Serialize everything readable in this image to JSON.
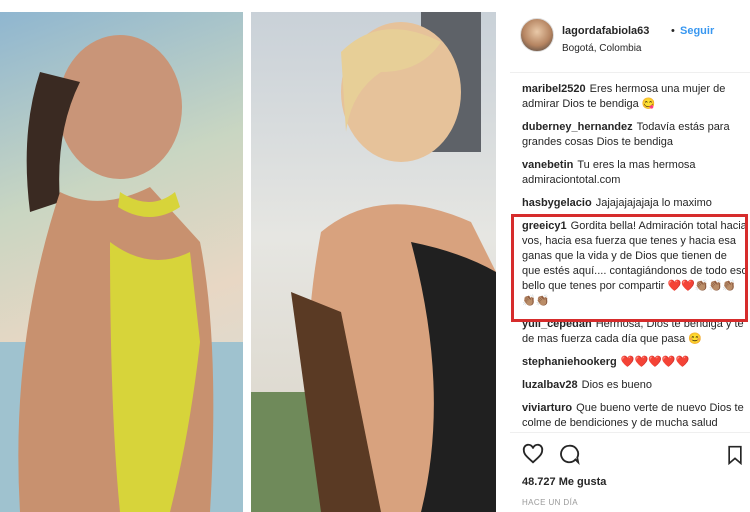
{
  "header": {
    "username": "lagordafabiola63",
    "separator": "•",
    "follow_label": "Seguir",
    "location": "Bogotá, Colombia"
  },
  "comments": [
    {
      "user": "maribel2520",
      "text": "Eres hermosa una mujer de admirar Dios te bendiga 😋"
    },
    {
      "user": "duberney_hernandez",
      "text": "Todavía estás para grandes cosas Dios te bendiga"
    },
    {
      "user": "vanebetin",
      "text": "Tu eres la mas hermosa admiraciontotal.com"
    },
    {
      "user": "hasbygelacio",
      "text": "Jajajajajajaja lo maximo"
    },
    {
      "user": "greeicy1",
      "text": "Gordita bella! Admiración total hacia vos, hacia esa fuerza que tenes y hacia esa ganas que la vida y de Dios que tienen de que estés aquí.... contagiándonos de todo eso bello que tenes por compartir ❤️❤️👏🏽👏🏽👏🏽👏🏽👏🏽"
    },
    {
      "user": "yuli_cepedah",
      "text": "Hermosa, Dios te bendiga y te de mas fuerza cada día que pasa 😊"
    },
    {
      "user": "stephaniehookerg",
      "text": "❤️❤️❤️❤️❤️"
    },
    {
      "user": "luzalbav28",
      "text": "Dios es bueno"
    },
    {
      "user": "viviarturo",
      "text": "Que bueno verte de nuevo Dios te colme de bendiciones y de mucha salud"
    }
  ],
  "actions": {
    "like_icon": "heart-icon",
    "comment_icon": "comment-icon",
    "save_icon": "bookmark-icon"
  },
  "likes": "48.727 Me gusta",
  "time": "HACE UN DÍA",
  "colors": {
    "highlight_border": "#d62c2c",
    "follow": "#3897f0",
    "text": "#262626"
  }
}
